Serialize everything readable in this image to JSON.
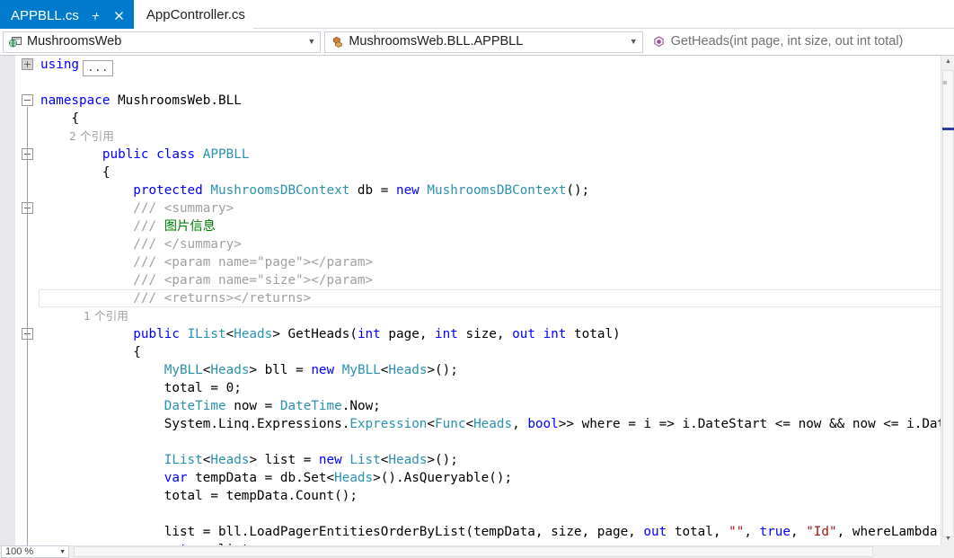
{
  "tabs": [
    {
      "label": "APPBLL.cs",
      "active": true,
      "pin_icon": "pin-icon",
      "close_icon": "close-icon"
    },
    {
      "label": "AppController.cs",
      "active": false
    }
  ],
  "navbar": {
    "project": {
      "icon": "project-web-icon",
      "value": "MushroomsWeb",
      "arrow": "▼"
    },
    "type": {
      "icon": "class-icon",
      "value": "MushroomsWeb.BLL.APPBLL",
      "arrow": "▼"
    },
    "member": {
      "icon": "method-icon",
      "value": "GetHeads(int page, int size, out int total)",
      "arrow": ""
    }
  },
  "editor": {
    "current_line_text": "/// <returns></returns>",
    "codelens_class": "2 个引用",
    "codelens_method": "1 个引用",
    "collapsed_using_placeholder": "...",
    "lines": [
      {
        "indent": 0,
        "segments": [
          {
            "t": "using",
            "c": "kw"
          }
        ],
        "collapsed_block": true,
        "outline": "plus"
      },
      {
        "indent": 0,
        "segments": []
      },
      {
        "indent": 0,
        "segments": [
          {
            "t": "namespace",
            "c": "kw"
          },
          {
            "t": " MushroomsWeb.BLL",
            "c": "plain"
          }
        ],
        "outline": "minus"
      },
      {
        "indent": 1,
        "segments": [
          {
            "t": "{",
            "c": "plain"
          }
        ]
      },
      {
        "indent": 2,
        "codelens": "2 个引用"
      },
      {
        "indent": 2,
        "segments": [
          {
            "t": "public class ",
            "c": "kw"
          },
          {
            "t": "APPBLL",
            "c": "typ"
          }
        ],
        "outline": "minus"
      },
      {
        "indent": 2,
        "segments": [
          {
            "t": "{",
            "c": "plain"
          }
        ]
      },
      {
        "indent": 3,
        "segments": [
          {
            "t": "protected ",
            "c": "kw"
          },
          {
            "t": "MushroomsDBContext",
            "c": "typ"
          },
          {
            "t": " db = ",
            "c": "plain"
          },
          {
            "t": "new ",
            "c": "kw"
          },
          {
            "t": "MushroomsDBContext",
            "c": "typ"
          },
          {
            "t": "();",
            "c": "plain"
          }
        ]
      },
      {
        "indent": 3,
        "segments": [
          {
            "t": "/// <summary>",
            "c": "cmt"
          }
        ],
        "outline": "minus"
      },
      {
        "indent": 3,
        "segments": [
          {
            "t": "/// ",
            "c": "cmt"
          },
          {
            "t": "图片信息",
            "c": "cmtzh"
          }
        ]
      },
      {
        "indent": 3,
        "segments": [
          {
            "t": "/// </summary>",
            "c": "cmt"
          }
        ]
      },
      {
        "indent": 3,
        "segments": [
          {
            "t": "/// <param name=\"page\"></param>",
            "c": "cmt"
          }
        ]
      },
      {
        "indent": 3,
        "segments": [
          {
            "t": "/// <param name=\"size\"></param>",
            "c": "cmt"
          }
        ]
      },
      {
        "indent": 3,
        "segments": [
          {
            "t": "/// <returns></returns>",
            "c": "cmt"
          }
        ],
        "current": true
      },
      {
        "indent": 3,
        "codelens": "1 个引用"
      },
      {
        "indent": 3,
        "segments": [
          {
            "t": "public ",
            "c": "kw"
          },
          {
            "t": "IList",
            "c": "typ"
          },
          {
            "t": "<",
            "c": "plain"
          },
          {
            "t": "Heads",
            "c": "typ"
          },
          {
            "t": "> GetHeads(",
            "c": "plain"
          },
          {
            "t": "int",
            "c": "kw"
          },
          {
            "t": " page, ",
            "c": "plain"
          },
          {
            "t": "int",
            "c": "kw"
          },
          {
            "t": " size, ",
            "c": "plain"
          },
          {
            "t": "out int",
            "c": "kw"
          },
          {
            "t": " total)",
            "c": "plain"
          }
        ],
        "outline": "minus"
      },
      {
        "indent": 3,
        "segments": [
          {
            "t": "{",
            "c": "plain"
          }
        ]
      },
      {
        "indent": 4,
        "segments": [
          {
            "t": "MyBLL",
            "c": "typ"
          },
          {
            "t": "<",
            "c": "plain"
          },
          {
            "t": "Heads",
            "c": "typ"
          },
          {
            "t": "> bll = ",
            "c": "plain"
          },
          {
            "t": "new ",
            "c": "kw"
          },
          {
            "t": "MyBLL",
            "c": "typ"
          },
          {
            "t": "<",
            "c": "plain"
          },
          {
            "t": "Heads",
            "c": "typ"
          },
          {
            "t": ">();",
            "c": "plain"
          }
        ]
      },
      {
        "indent": 4,
        "segments": [
          {
            "t": "total = 0;",
            "c": "plain"
          }
        ]
      },
      {
        "indent": 4,
        "segments": [
          {
            "t": "DateTime",
            "c": "typ"
          },
          {
            "t": " now = ",
            "c": "plain"
          },
          {
            "t": "DateTime",
            "c": "typ"
          },
          {
            "t": ".Now;",
            "c": "plain"
          }
        ]
      },
      {
        "indent": 4,
        "segments": [
          {
            "t": "System.Linq.Expressions.",
            "c": "plain"
          },
          {
            "t": "Expression",
            "c": "typ"
          },
          {
            "t": "<",
            "c": "plain"
          },
          {
            "t": "Func",
            "c": "typ"
          },
          {
            "t": "<",
            "c": "plain"
          },
          {
            "t": "Heads",
            "c": "typ"
          },
          {
            "t": ", ",
            "c": "plain"
          },
          {
            "t": "bool",
            "c": "kw"
          },
          {
            "t": ">> where = i => i.DateStart <= now && now <= i.DateEnd;",
            "c": "plain"
          }
        ]
      },
      {
        "indent": 4,
        "segments": []
      },
      {
        "indent": 4,
        "segments": [
          {
            "t": "IList",
            "c": "typ"
          },
          {
            "t": "<",
            "c": "plain"
          },
          {
            "t": "Heads",
            "c": "typ"
          },
          {
            "t": "> list = ",
            "c": "plain"
          },
          {
            "t": "new ",
            "c": "kw"
          },
          {
            "t": "List",
            "c": "typ"
          },
          {
            "t": "<",
            "c": "plain"
          },
          {
            "t": "Heads",
            "c": "typ"
          },
          {
            "t": ">();",
            "c": "plain"
          }
        ]
      },
      {
        "indent": 4,
        "segments": [
          {
            "t": "var",
            "c": "kw"
          },
          {
            "t": " tempData = db.Set<",
            "c": "plain"
          },
          {
            "t": "Heads",
            "c": "typ"
          },
          {
            "t": ">().AsQueryable();",
            "c": "plain"
          }
        ]
      },
      {
        "indent": 4,
        "segments": [
          {
            "t": "total = tempData.Count();",
            "c": "plain"
          }
        ]
      },
      {
        "indent": 4,
        "segments": []
      },
      {
        "indent": 4,
        "segments": [
          {
            "t": "list = bll.LoadPagerEntitiesOrderByList(tempData, size, page, ",
            "c": "plain"
          },
          {
            "t": "out",
            "c": "kw"
          },
          {
            "t": " total, ",
            "c": "plain"
          },
          {
            "t": "\"\"",
            "c": "str"
          },
          {
            "t": ", ",
            "c": "plain"
          },
          {
            "t": "true",
            "c": "kw"
          },
          {
            "t": ", ",
            "c": "plain"
          },
          {
            "t": "\"Id\"",
            "c": "str"
          },
          {
            "t": ", whereLambda: where).ToLis",
            "c": "plain"
          }
        ]
      },
      {
        "indent": 4,
        "segments": [
          {
            "t": "return",
            "c": "kw"
          },
          {
            "t": " list;",
            "c": "plain"
          }
        ]
      }
    ]
  },
  "scrollbars": {
    "vertical": {
      "up_arrow": "▲",
      "down_arrow": "▼"
    },
    "zoom_level": "100 %",
    "zoom_arrow": "▼"
  }
}
